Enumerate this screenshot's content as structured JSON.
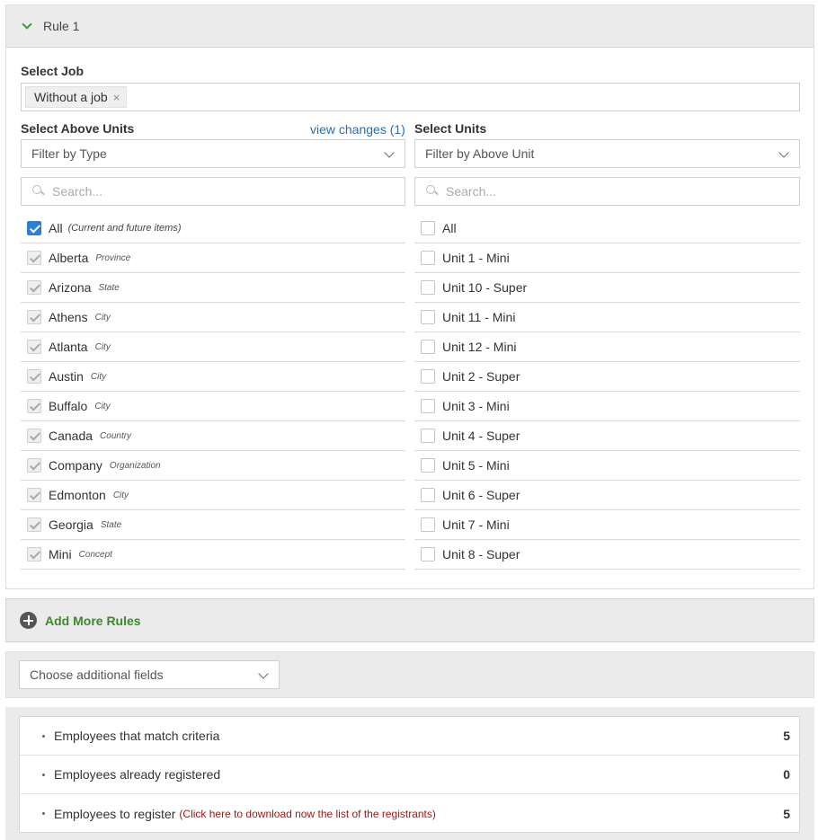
{
  "rule": {
    "title": "Rule 1"
  },
  "job": {
    "label": "Select Job",
    "chip": "Without a job",
    "chip_remove": "×"
  },
  "above_units": {
    "label": "Select Above Units",
    "view_changes": "view changes (1)",
    "filter_placeholder": "Filter by Type",
    "search_placeholder": "Search...",
    "all_label": "All",
    "all_hint": "(Current and future items)",
    "items": [
      {
        "label": "Alberta",
        "type": "Province"
      },
      {
        "label": "Arizona",
        "type": "State"
      },
      {
        "label": "Athens",
        "type": "City"
      },
      {
        "label": "Atlanta",
        "type": "City"
      },
      {
        "label": "Austin",
        "type": "City"
      },
      {
        "label": "Buffalo",
        "type": "City"
      },
      {
        "label": "Canada",
        "type": "Country"
      },
      {
        "label": "Company",
        "type": "Organization"
      },
      {
        "label": "Edmonton",
        "type": "City"
      },
      {
        "label": "Georgia",
        "type": "State"
      },
      {
        "label": "Mini",
        "type": "Concept"
      }
    ]
  },
  "units": {
    "label": "Select Units",
    "filter_placeholder": "Filter by Above Unit",
    "search_placeholder": "Search...",
    "all_label": "All",
    "items": [
      "Unit 1 - Mini",
      "Unit 10 - Super",
      "Unit 11 - Mini",
      "Unit 12 - Mini",
      "Unit 2 - Super",
      "Unit 3 - Mini",
      "Unit 4 - Super",
      "Unit 5 - Mini",
      "Unit 6 - Super",
      "Unit 7 - Mini",
      "Unit 8 - Super"
    ]
  },
  "add_rules": {
    "label": "Add More Rules"
  },
  "additional_fields": {
    "placeholder": "Choose additional fields"
  },
  "summary": {
    "rows": [
      {
        "label": "Employees that match criteria",
        "value": "5"
      },
      {
        "label": "Employees already registered",
        "value": "0"
      },
      {
        "label": "Employees to register",
        "link": "(Click here to download now the list of the registrants)",
        "value": "5"
      }
    ]
  },
  "colors": {
    "accent_green": "#3a8a2a",
    "link_blue": "#2a6fb0",
    "checkbox_blue": "#2b7fd4",
    "download_link_red": "#a01818"
  }
}
